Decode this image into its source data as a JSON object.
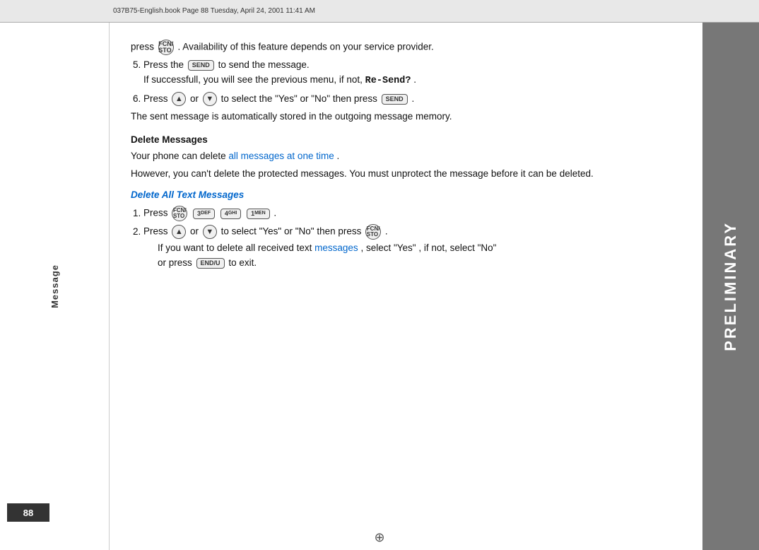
{
  "header": {
    "text": "037B75-English.book  Page 88  Tuesday, April 24, 2001  11:41 AM"
  },
  "sidebar": {
    "label": "Message"
  },
  "page_number": "88",
  "preliminary": "PRELIMINARY",
  "content": {
    "intro_text": "press",
    "intro_btn": "FCN/STO",
    "intro_rest": ". Availability of this feature depends on your service provider.",
    "step5_label": "5.",
    "step5_text": "Press the",
    "step5_btn": "SEND",
    "step5_rest": "to send the message.",
    "step5_sub": "If successfull, you will see the previous menu, if not,",
    "resend": "Re-Send?",
    "step5_sub_end": ".",
    "step6_label": "6.",
    "step6_press": "Press",
    "step6_or": "or",
    "step6_rest": "to select the \"Yes\" or \"No\" then press",
    "step6_btn_end": "SEND",
    "step6_end": ".",
    "sent_msg": "The sent message is automatically stored in the outgoing message memory.",
    "delete_heading": "Delete Messages",
    "delete_intro": "Your phone can delete",
    "delete_link": "all messages at one time",
    "delete_rest": ".",
    "delete_sub": "However, you can't delete the protected messages. You must unprotect the message before it can be deleted.",
    "delete_all_heading": "Delete All Text Messages",
    "d_step1_label": "1.",
    "d_step1_press": "Press",
    "d_step1_btn1": "FCN/STO",
    "d_step1_btn2": "3DEF",
    "d_step1_btn3": "4GHI",
    "d_step1_btn4": "1MEN",
    "d_step2_label": "2.",
    "d_step2_press": "Press",
    "d_step2_or": "or",
    "d_step2_rest": "to select \"Yes\" or \"No\" then press",
    "d_step2_btn_end": "FCN/STO",
    "d_step2_end": ".",
    "d_step2_sub1": "If you want to delete all received text",
    "d_step2_sub_link": "messages",
    "d_step2_sub2": ", select \"Yes\" , if not, select \"No\"",
    "d_step2_sub3": "or press",
    "d_step2_sub_btn": "END/U",
    "d_step2_sub4": "to exit."
  }
}
